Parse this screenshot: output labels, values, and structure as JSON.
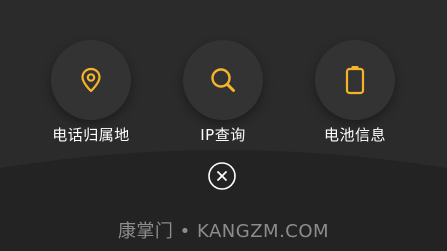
{
  "colors": {
    "background": "#232323",
    "panel": "#2a2a2a",
    "button": "#333333",
    "accent": "#f5b52a",
    "label": "#ffffff",
    "watermark": "#8c8c8c"
  },
  "tools": [
    {
      "label": "电话归属地",
      "icon": "location-pin-icon"
    },
    {
      "label": "IP查询",
      "icon": "search-icon"
    },
    {
      "label": "电池信息",
      "icon": "battery-icon"
    }
  ],
  "close": {
    "icon": "close-icon"
  },
  "watermark": {
    "text": "康掌门 • KANGZM.COM"
  }
}
